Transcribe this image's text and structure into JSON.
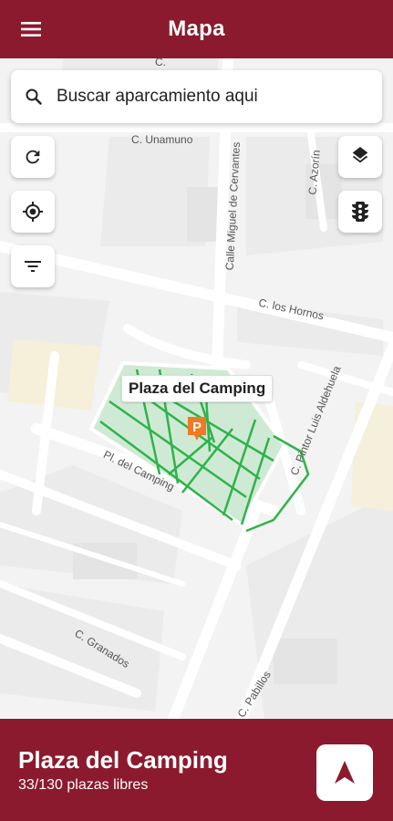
{
  "appbar": {
    "title": "Mapa",
    "menu_icon": "hamburger-menu-icon"
  },
  "search": {
    "placeholder": "Buscar aparcamiento aqui",
    "icon": "search-icon"
  },
  "map_controls": {
    "left": [
      "refresh-icon",
      "my-location-icon",
      "filter-icon"
    ],
    "right": [
      "layers-icon",
      "traffic-light-icon"
    ]
  },
  "map": {
    "place_label": "Plaza del Camping",
    "parking_marker": "P",
    "parking_color": "#f07a23",
    "zone_color": "#2fb34a",
    "streets": {
      "unamuno": "C. Unamuno",
      "cervantes": "Calle Miguel de Cervantes",
      "azorin": "C. Azorín",
      "hornos": "C. los Hornos",
      "camping": "Pl. del Camping",
      "aldehuela": "C. Pintor Luis Aldehuela",
      "granados": "C. Granados",
      "pabillos": "C. Pabillos",
      "top_partial": "C."
    }
  },
  "bottom_panel": {
    "name": "Plaza del Camping",
    "availability": "33/130 plazas libres",
    "nav_icon": "navigation-arrow-icon"
  },
  "colors": {
    "brand": "#8b1a2e"
  }
}
